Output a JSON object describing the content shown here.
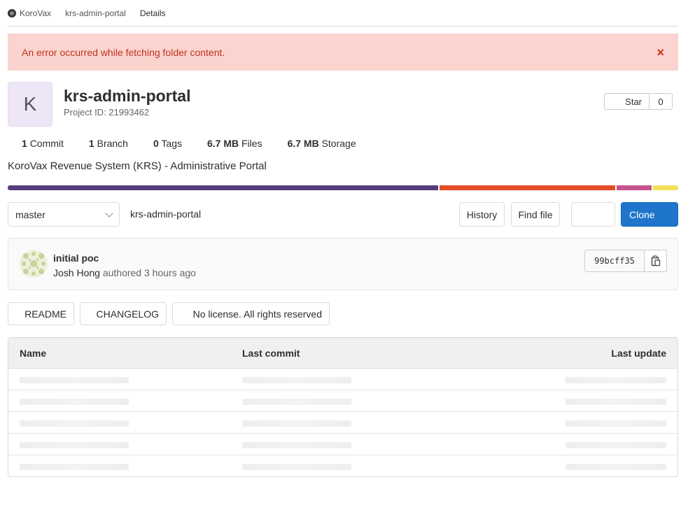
{
  "breadcrumb": {
    "group": "KoroVax",
    "project": "krs-admin-portal",
    "current": "Details"
  },
  "alert": {
    "message": "An error occurred while fetching folder content.",
    "close_icon": "close-icon",
    "close_symbol": "×"
  },
  "project": {
    "avatar_letter": "K",
    "name": "krs-admin-portal",
    "id_label": "Project ID: 21993462",
    "description": "KoroVax Revenue System (KRS) - Administrative Portal",
    "star_label": "Star",
    "star_count": "0"
  },
  "stats": [
    {
      "value": "1",
      "label": "Commit"
    },
    {
      "value": "1",
      "label": "Branch"
    },
    {
      "value": "0",
      "label": "Tags"
    },
    {
      "value": "6.7 MB",
      "label": "Files"
    },
    {
      "value": "6.7 MB",
      "label": "Storage"
    }
  ],
  "languages": [
    {
      "color": "#563d7c",
      "fraction": 0.644
    },
    {
      "color": "#e34c26",
      "fraction": 0.264
    },
    {
      "color": "#c6538c",
      "fraction": 0.054
    },
    {
      "color": "#f1e05a",
      "fraction": 0.038
    }
  ],
  "toolbar": {
    "branch": "master",
    "path": "krs-admin-portal",
    "history": "History",
    "find_file": "Find file",
    "clone": "Clone"
  },
  "commit": {
    "title": "initial poc",
    "author": "Josh Hong",
    "meta": "authored 3 hours ago",
    "sha": "99bcff35",
    "copy_icon": "clipboard-icon"
  },
  "chips": {
    "readme": "README",
    "changelog": "CHANGELOG",
    "license": "No license. All rights reserved"
  },
  "table": {
    "headers": {
      "name": "Name",
      "last_commit": "Last commit",
      "last_update": "Last update"
    },
    "loading_rows": 5
  },
  "colors": {
    "accent": "#1f75cb",
    "alert_bg": "#fbd3cf",
    "alert_text": "#c0341d"
  }
}
